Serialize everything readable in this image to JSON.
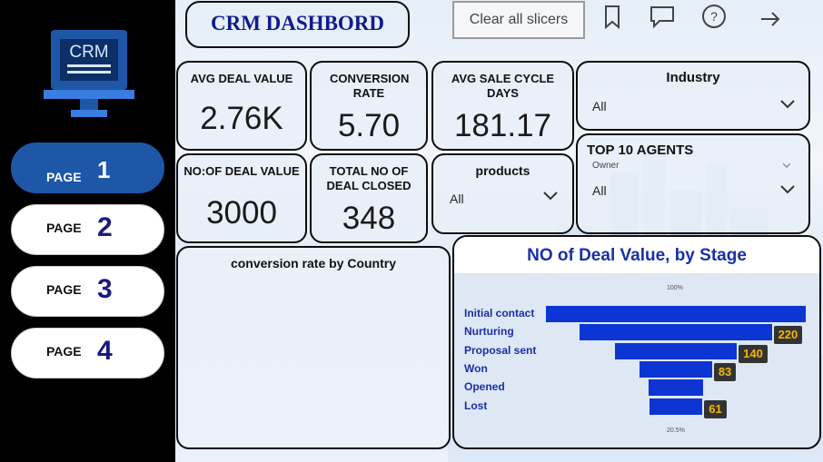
{
  "sidebar": {
    "logo_text": "CRM",
    "pages": [
      {
        "label": "PAGE",
        "num": "1",
        "active": true
      },
      {
        "label": "PAGE",
        "num": "2",
        "active": false
      },
      {
        "label": "PAGE",
        "num": "3",
        "active": false
      },
      {
        "label": "PAGE",
        "num": "4",
        "active": false
      }
    ]
  },
  "header": {
    "title": "CRM DASHBORD",
    "clear_label": "Clear all slicers",
    "icons": [
      "bookmark-icon",
      "comment-icon",
      "help-icon",
      "arrow-right-icon"
    ]
  },
  "kpis": {
    "avg_deal": {
      "title": "AVG DEAL VALUE",
      "value": "2.76K"
    },
    "conversion": {
      "title": "CONVERSION RATE",
      "value": "5.70"
    },
    "cycle": {
      "title": "AVG SALE CYCLE DAYS",
      "value": "181.17"
    },
    "deal_count": {
      "title": "NO:OF DEAL VALUE",
      "value": "3000"
    },
    "closed": {
      "title": "TOTAL NO OF DEAL CLOSED",
      "value": "348"
    }
  },
  "slicers": {
    "industry": {
      "label": "Industry",
      "value": "All"
    },
    "products": {
      "label": "products",
      "value": "All"
    },
    "agents": {
      "label": "TOP 10 AGENTS",
      "sub": "Owner",
      "value": "All"
    }
  },
  "map_card": {
    "title": "conversion rate by Country"
  },
  "chart_data": {
    "type": "bar",
    "title": "NO of Deal Value, by Stage",
    "categories": [
      "Initial contact",
      "Nurturing",
      "Proposal sent",
      "Won",
      "Opened",
      "Lost"
    ],
    "values": [
      298,
      220,
      140,
      83,
      63,
      61
    ],
    "data_labels": [
      "",
      "220",
      "140",
      "83",
      "",
      "61"
    ],
    "top_percent": "100%",
    "bottom_percent": "20.5%"
  },
  "colors": {
    "accent": "#1f57a8",
    "bar": "#0d35d4",
    "label_text": "#f5b800",
    "title_text": "#0f1b8c"
  }
}
